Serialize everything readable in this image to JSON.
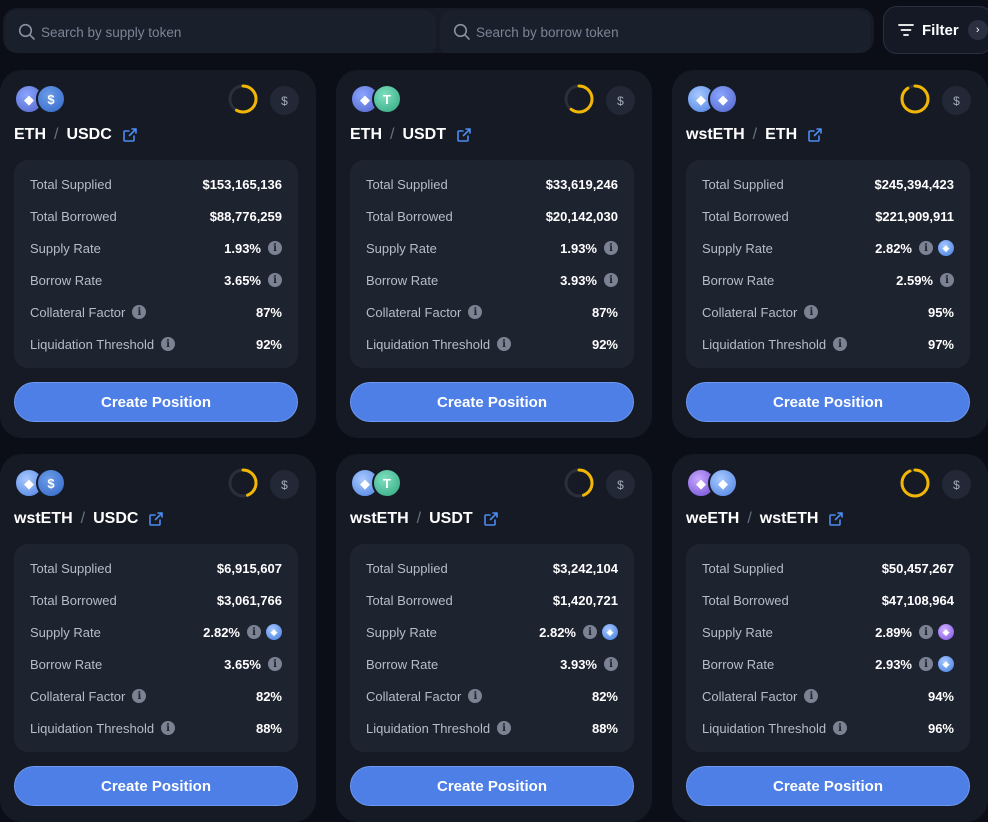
{
  "search": {
    "supply_placeholder": "Search by supply token",
    "borrow_placeholder": "Search by borrow token"
  },
  "filter": {
    "label": "Filter"
  },
  "labels": {
    "total_supplied": "Total Supplied",
    "total_borrowed": "Total Borrowed",
    "supply_rate": "Supply Rate",
    "borrow_rate": "Borrow Rate",
    "collateral_factor": "Collateral Factor",
    "liquidation_threshold": "Liquidation Threshold",
    "create_position": "Create Position",
    "currency_badge": "$",
    "slash": "/"
  },
  "colors": {
    "accent": "#4d7fe6",
    "ring_progress": "#f2b705",
    "background": "#0b0e16",
    "card": "#151a25"
  },
  "markets": [
    {
      "supply_token": "ETH",
      "borrow_token": "USDC",
      "supply_icon": "eth-icon",
      "borrow_icon": "usdc-icon",
      "total_supplied": "$153,165,136",
      "total_borrowed": "$88,776,259",
      "supply_rate": "1.93%",
      "borrow_rate": "3.65%",
      "collateral_factor": "87%",
      "liquidation_threshold": "92%",
      "utilization": 0.58,
      "supply_reward_icon": "",
      "borrow_reward_icon": ""
    },
    {
      "supply_token": "ETH",
      "borrow_token": "USDT",
      "supply_icon": "eth-icon",
      "borrow_icon": "usdt-icon",
      "total_supplied": "$33,619,246",
      "total_borrowed": "$20,142,030",
      "supply_rate": "1.93%",
      "borrow_rate": "3.93%",
      "collateral_factor": "87%",
      "liquidation_threshold": "92%",
      "utilization": 0.6,
      "supply_reward_icon": "",
      "borrow_reward_icon": ""
    },
    {
      "supply_token": "wstETH",
      "borrow_token": "ETH",
      "supply_icon": "wsteth-icon",
      "borrow_icon": "eth-icon",
      "total_supplied": "$245,394,423",
      "total_borrowed": "$221,909,911",
      "supply_rate": "2.82%",
      "borrow_rate": "2.59%",
      "collateral_factor": "95%",
      "liquidation_threshold": "97%",
      "utilization": 0.9,
      "supply_reward_icon": "wsteth-icon",
      "borrow_reward_icon": ""
    },
    {
      "supply_token": "wstETH",
      "borrow_token": "USDC",
      "supply_icon": "wsteth-icon",
      "borrow_icon": "usdc-icon",
      "total_supplied": "$6,915,607",
      "total_borrowed": "$3,061,766",
      "supply_rate": "2.82%",
      "borrow_rate": "3.65%",
      "collateral_factor": "82%",
      "liquidation_threshold": "88%",
      "utilization": 0.44,
      "supply_reward_icon": "wsteth-icon",
      "borrow_reward_icon": ""
    },
    {
      "supply_token": "wstETH",
      "borrow_token": "USDT",
      "supply_icon": "wsteth-icon",
      "borrow_icon": "usdt-icon",
      "total_supplied": "$3,242,104",
      "total_borrowed": "$1,420,721",
      "supply_rate": "2.82%",
      "borrow_rate": "3.93%",
      "collateral_factor": "82%",
      "liquidation_threshold": "88%",
      "utilization": 0.44,
      "supply_reward_icon": "wsteth-icon",
      "borrow_reward_icon": ""
    },
    {
      "supply_token": "weETH",
      "borrow_token": "wstETH",
      "supply_icon": "weeth-icon",
      "borrow_icon": "wsteth-icon",
      "total_supplied": "$50,457,267",
      "total_borrowed": "$47,108,964",
      "supply_rate": "2.89%",
      "borrow_rate": "2.93%",
      "collateral_factor": "94%",
      "liquidation_threshold": "96%",
      "utilization": 0.93,
      "supply_reward_icon": "weeth-icon",
      "borrow_reward_icon": "wsteth-icon"
    }
  ]
}
